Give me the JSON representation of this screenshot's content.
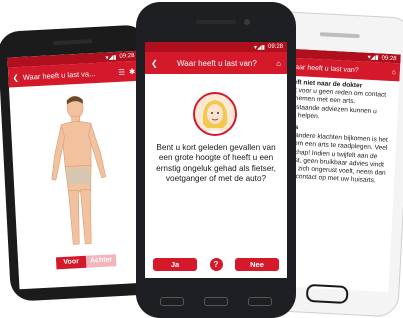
{
  "left": {
    "status": "09:28",
    "title": "Waar heeft u last va...",
    "toggle": [
      "Voor",
      "Achter"
    ]
  },
  "center": {
    "status": "09:28",
    "title": "Waar heeft u last van?",
    "question": "Bent u kort geleden gevallen van een grote hoogte of heeft u een ernstig ongeluk gehad als fietser, voetganger of met de auto?",
    "yes": "Ja",
    "help": "?",
    "no": "Nee"
  },
  "right": {
    "status": "09:28",
    "title": "Waar heeft u last van?",
    "heading1": "U heeft niet naar de dokter",
    "body1": "Er lijkt voor u geen reden om contact op te nemen met een arts. Onderstaande adviezen kunnen u verder helpen.",
    "heading2": "Advies",
    "body2": "Als er andere klachten bijkomen is het nodig om een arts te raadplegen. Veel beterschap! Indien u twijfelt aan de uitkomst, geen bruikbaar advies vindt of als u zich ongerust voelt, neem dan alsnog contact op met uw huisarts."
  }
}
